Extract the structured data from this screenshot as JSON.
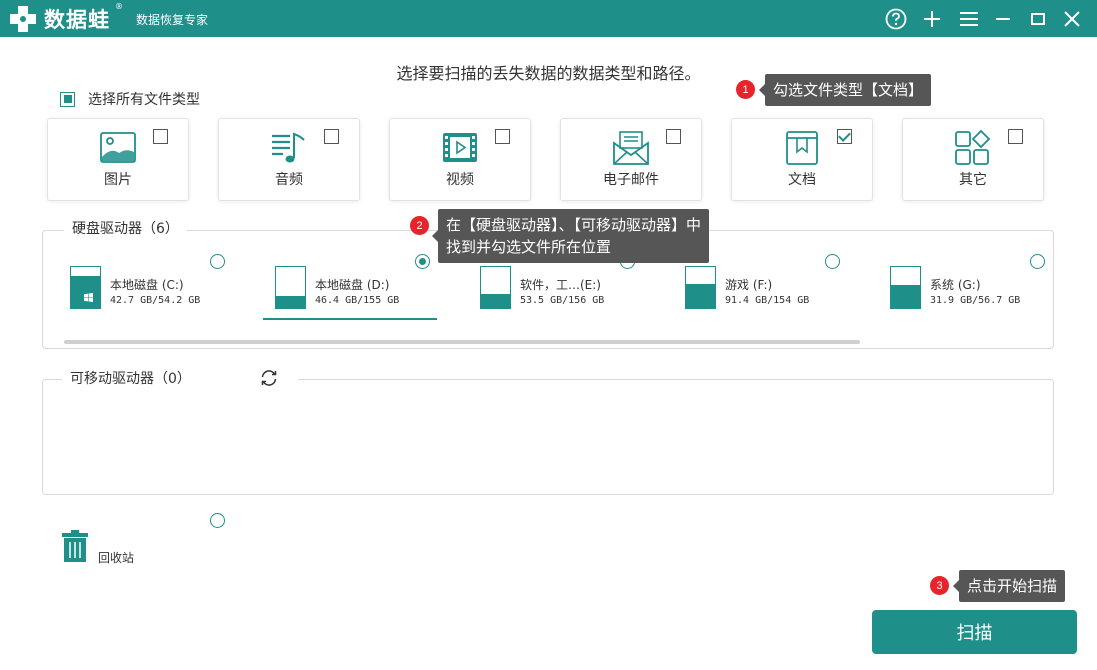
{
  "app": {
    "brand": "数据蛙",
    "brand_mark": "®",
    "subtitle": "数据恢复专家"
  },
  "titlebar_buttons": [
    "help-icon",
    "plus-icon",
    "menu-icon",
    "minimize-icon",
    "maximize-icon",
    "close-icon"
  ],
  "instruction": "选择要扫描的丢失数据的数据类型和路径。",
  "select_all": {
    "label": "选择所有文件类型",
    "checked": true
  },
  "file_types": [
    {
      "label": "图片",
      "icon": "picture-icon",
      "checked": false
    },
    {
      "label": "音频",
      "icon": "audio-icon",
      "checked": false
    },
    {
      "label": "视频",
      "icon": "video-icon",
      "checked": false
    },
    {
      "label": "电子邮件",
      "icon": "email-icon",
      "checked": false
    },
    {
      "label": "文档",
      "icon": "document-icon",
      "checked": true
    },
    {
      "label": "其它",
      "icon": "other-icon",
      "checked": false
    }
  ],
  "hard_drives": {
    "title": "硬盘驱动器（6）",
    "items": [
      {
        "name": "本地磁盘 (C:)",
        "size": "42.7 GB/54.2 GB",
        "used": 0.79,
        "selected": false
      },
      {
        "name": "本地磁盘 (D:)",
        "size": "46.4 GB/155 GB",
        "used": 0.3,
        "selected": true
      },
      {
        "name": "软件，工…(E:)",
        "size": "53.5 GB/156 GB",
        "used": 0.34,
        "selected": false
      },
      {
        "name": "游戏 (F:)",
        "size": "91.4 GB/154 GB",
        "used": 0.59,
        "selected": false
      },
      {
        "name": "系统 (G:)",
        "size": "31.9 GB/56.7 GB",
        "used": 0.56,
        "selected": false
      }
    ]
  },
  "removable_drives": {
    "title": "可移动驱动器（0）"
  },
  "recycle_bin": {
    "label": "回收站",
    "selected": false
  },
  "tips": {
    "tip1": {
      "num": "1",
      "text": "勾选文件类型【文档】"
    },
    "tip2": {
      "num": "2",
      "line1": "在【硬盘驱动器】、【可移动驱动器】中",
      "line2": "找到并勾选文件所在位置"
    },
    "tip3": {
      "num": "3",
      "text": "点击开始扫描"
    }
  },
  "scan_button": "扫描",
  "colors": {
    "accent": "#1f8f8a",
    "badge": "#e8232b",
    "tooltip": "#565656"
  }
}
